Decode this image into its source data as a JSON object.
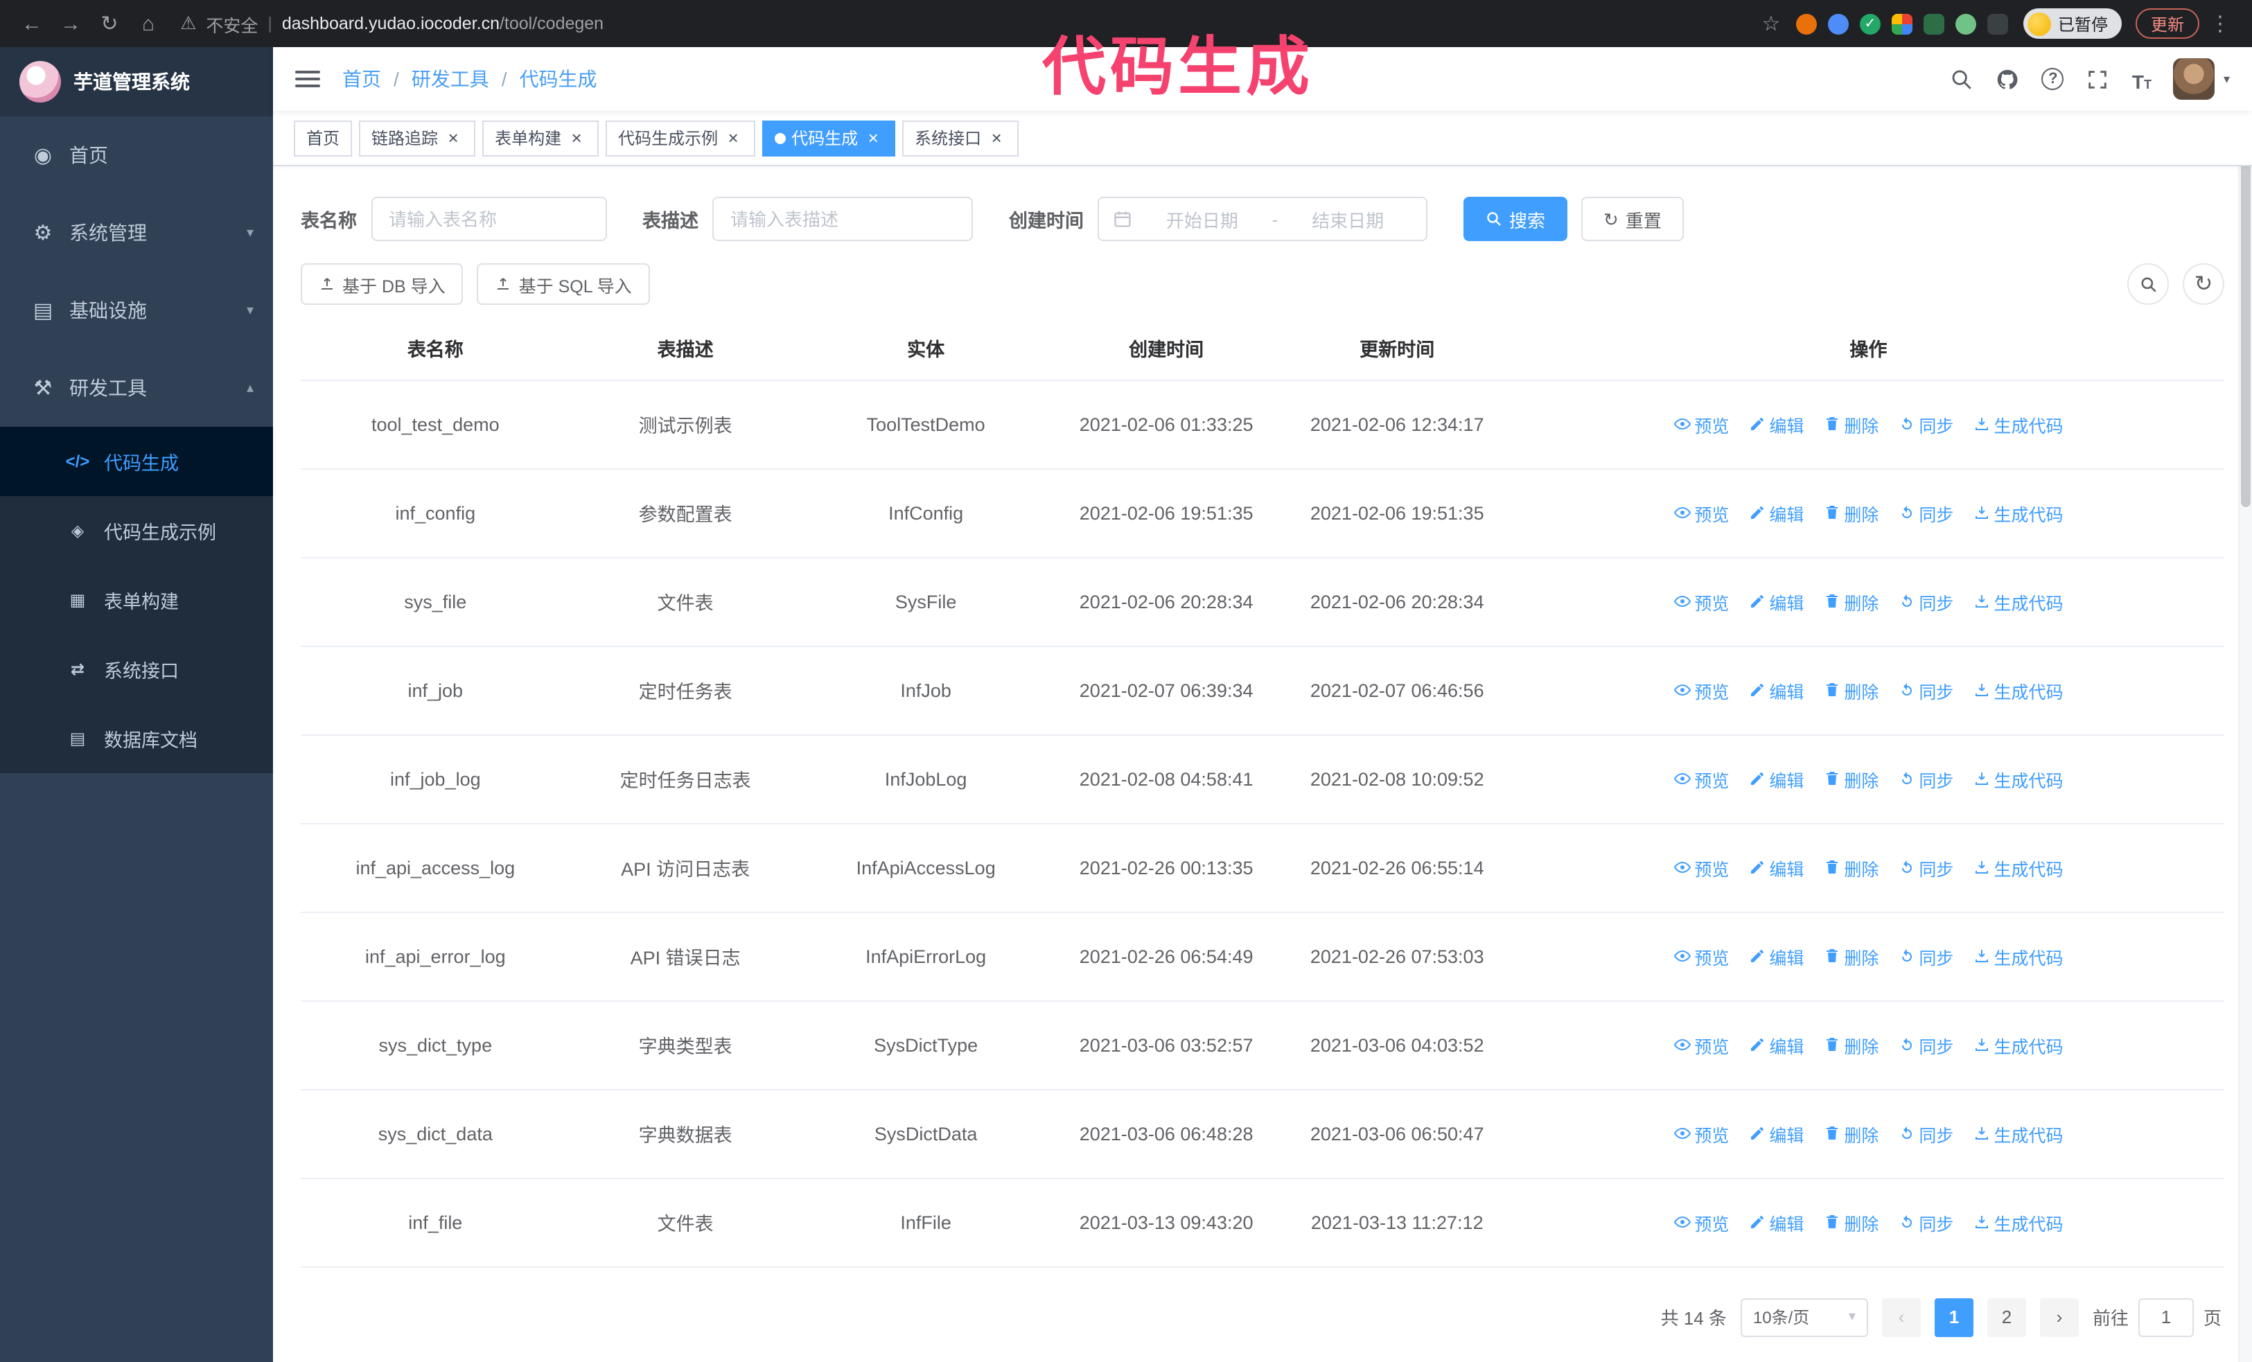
{
  "accent_color": "#409eff",
  "annotation": {
    "text": "代码生成",
    "color": "#f5426f"
  },
  "browser": {
    "security_label": "不安全",
    "url_host": "dashboard.yudao.iocoder.cn",
    "url_path": "/tool/codegen",
    "paused_badge": "已暂停",
    "update_button": "更新",
    "icons": [
      "back-icon",
      "forward-icon",
      "reload-icon",
      "home-icon",
      "bookmark-star-icon",
      "extensions",
      "profile-avatar-icon",
      "kebab-menu-icon"
    ]
  },
  "sidebar": {
    "logo_title": "芋道管理系统",
    "items": [
      {
        "label": "首页",
        "icon": "dashboard-icon",
        "state": "none"
      },
      {
        "label": "系统管理",
        "icon": "gear-icon",
        "state": "collapsed"
      },
      {
        "label": "基础设施",
        "icon": "infrastructure-icon",
        "state": "collapsed"
      },
      {
        "label": "研发工具",
        "icon": "tools-icon",
        "state": "expanded"
      }
    ],
    "subitems": [
      {
        "label": "代码生成",
        "icon": "code-icon",
        "active": true
      },
      {
        "label": "代码生成示例",
        "icon": "example-icon",
        "active": false
      },
      {
        "label": "表单构建",
        "icon": "form-icon",
        "active": false
      },
      {
        "label": "系统接口",
        "icon": "api-icon",
        "active": false
      },
      {
        "label": "数据库文档",
        "icon": "database-icon",
        "active": false
      }
    ]
  },
  "header": {
    "breadcrumb": [
      "首页",
      "研发工具",
      "代码生成"
    ],
    "breadcrumb_separator": "/",
    "right_icons": [
      "search-icon",
      "github-icon",
      "help-icon",
      "fullscreen-icon",
      "font-size-icon",
      "avatar",
      "chevron-down-icon"
    ]
  },
  "tabs": [
    {
      "label": "首页",
      "active": false,
      "closable": false
    },
    {
      "label": "链路追踪",
      "active": false,
      "closable": true
    },
    {
      "label": "表单构建",
      "active": false,
      "closable": true
    },
    {
      "label": "代码生成示例",
      "active": false,
      "closable": true
    },
    {
      "label": "代码生成",
      "active": true,
      "closable": true
    },
    {
      "label": "系统接口",
      "active": false,
      "closable": true
    }
  ],
  "filters": {
    "table_name": {
      "label": "表名称",
      "placeholder": "请输入表名称",
      "value": ""
    },
    "table_desc": {
      "label": "表描述",
      "placeholder": "请输入表描述",
      "value": ""
    },
    "create_time": {
      "label": "创建时间",
      "start_placeholder": "开始日期",
      "separator": "-",
      "end_placeholder": "结束日期"
    },
    "search_label": "搜索",
    "reset_label": "重置"
  },
  "toolbar": {
    "import_db_label": "基于 DB 导入",
    "import_sql_label": "基于 SQL 导入",
    "mini_buttons": [
      "search-icon",
      "refresh-icon"
    ]
  },
  "table": {
    "columns": [
      "表名称",
      "表描述",
      "实体",
      "创建时间",
      "更新时间",
      "操作"
    ],
    "actions": [
      "预览",
      "编辑",
      "删除",
      "同步",
      "生成代码"
    ],
    "action_icons": [
      "eye-icon",
      "edit-pencil-icon",
      "trash-icon",
      "sync-icon",
      "download-icon"
    ],
    "rows": [
      {
        "name": "tool_test_demo",
        "desc": "测试示例表",
        "entity": "ToolTestDemo",
        "created": "2021-02-06 01:33:25",
        "updated": "2021-02-06 12:34:17"
      },
      {
        "name": "inf_config",
        "desc": "参数配置表",
        "entity": "InfConfig",
        "created": "2021-02-06 19:51:35",
        "updated": "2021-02-06 19:51:35"
      },
      {
        "name": "sys_file",
        "desc": "文件表",
        "entity": "SysFile",
        "created": "2021-02-06 20:28:34",
        "updated": "2021-02-06 20:28:34"
      },
      {
        "name": "inf_job",
        "desc": "定时任务表",
        "entity": "InfJob",
        "created": "2021-02-07 06:39:34",
        "updated": "2021-02-07 06:46:56"
      },
      {
        "name": "inf_job_log",
        "desc": "定时任务日志表",
        "entity": "InfJobLog",
        "created": "2021-02-08 04:58:41",
        "updated": "2021-02-08 10:09:52"
      },
      {
        "name": "inf_api_access_log",
        "desc": "API 访问日志表",
        "entity": "InfApiAccessLog",
        "created": "2021-02-26 00:13:35",
        "updated": "2021-02-26 06:55:14"
      },
      {
        "name": "inf_api_error_log",
        "desc": "API 错误日志",
        "entity": "InfApiErrorLog",
        "created": "2021-02-26 06:54:49",
        "updated": "2021-02-26 07:53:03"
      },
      {
        "name": "sys_dict_type",
        "desc": "字典类型表",
        "entity": "SysDictType",
        "created": "2021-03-06 03:52:57",
        "updated": "2021-03-06 04:03:52"
      },
      {
        "name": "sys_dict_data",
        "desc": "字典数据表",
        "entity": "SysDictData",
        "created": "2021-03-06 06:48:28",
        "updated": "2021-03-06 06:50:47"
      },
      {
        "name": "inf_file",
        "desc": "文件表",
        "entity": "InfFile",
        "created": "2021-03-13 09:43:20",
        "updated": "2021-03-13 11:27:12"
      }
    ]
  },
  "pagination": {
    "total_label": "共 14 条",
    "page_size_label": "10条/页",
    "pages": [
      "1",
      "2"
    ],
    "active_page": "1",
    "goto_prefix": "前往",
    "goto_value": "1",
    "goto_suffix": "页"
  }
}
